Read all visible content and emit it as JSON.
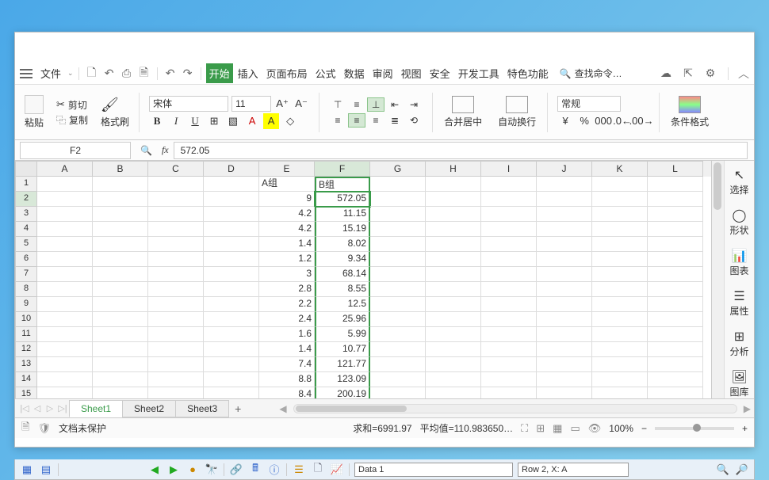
{
  "menu": {
    "file": "文件",
    "tabs": [
      "开始",
      "插入",
      "页面布局",
      "公式",
      "数据",
      "审阅",
      "视图",
      "安全",
      "开发工具",
      "特色功能"
    ],
    "search": "查找命令…"
  },
  "ribbon": {
    "paste": "粘贴",
    "cut": "剪切",
    "copy": "复制",
    "format_painter": "格式刷",
    "font": "宋体",
    "size": "11",
    "merge": "合并居中",
    "wrap": "自动换行",
    "number_format": "常规",
    "cond_format": "条件格式"
  },
  "formula": {
    "cell_ref": "F2",
    "value": "572.05"
  },
  "columns": [
    "A",
    "B",
    "C",
    "D",
    "E",
    "F",
    "G",
    "H",
    "I",
    "J",
    "K",
    "L"
  ],
  "rows": [
    "1",
    "2",
    "3",
    "4",
    "5",
    "6",
    "7",
    "8",
    "9",
    "10",
    "11",
    "12",
    "13",
    "14",
    "15"
  ],
  "headers": {
    "E": "A组",
    "F": "B组"
  },
  "chart_data": {
    "type": "table",
    "columns": [
      "A组",
      "B组"
    ],
    "rows": [
      [
        9,
        572.05
      ],
      [
        4.2,
        11.15
      ],
      [
        4.2,
        15.19
      ],
      [
        1.4,
        8.02
      ],
      [
        1.2,
        9.34
      ],
      [
        3,
        68.14
      ],
      [
        2.8,
        8.55
      ],
      [
        2.2,
        12.5
      ],
      [
        2.4,
        25.96
      ],
      [
        1.6,
        5.99
      ],
      [
        1.4,
        10.77
      ],
      [
        7.4,
        121.77
      ],
      [
        8.8,
        123.09
      ],
      [
        8.4,
        200.19
      ]
    ]
  },
  "sheets": {
    "active": "Sheet1",
    "others": [
      "Sheet2",
      "Sheet3"
    ]
  },
  "status": {
    "protect": "文档未保护",
    "sum": "求和=6991.97",
    "avg": "平均值=110.983650…",
    "zoom": "100%"
  },
  "side": {
    "select": "选择",
    "shape": "形状",
    "chart": "图表",
    "prop": "属性",
    "analyze": "分析",
    "gallery": "图库"
  },
  "bottom": {
    "data": "Data 1",
    "rowinfo": "Row 2, X: A"
  }
}
